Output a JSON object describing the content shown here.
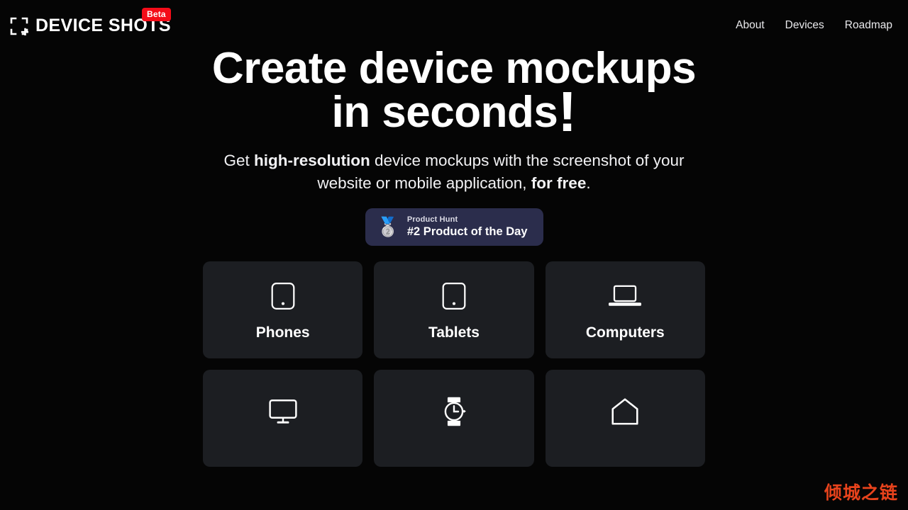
{
  "header": {
    "brand_name": "DEVICE SHOTS",
    "brand_icon": "crop-frame-plus-icon",
    "beta_label": "Beta",
    "nav": [
      {
        "label": "About"
      },
      {
        "label": "Devices"
      },
      {
        "label": "Roadmap"
      }
    ]
  },
  "hero": {
    "headline_main": "Create device mockups in seconds",
    "headline_bang": "!",
    "subhead": {
      "part1": "Get ",
      "bold1": "high-resolution",
      "part2": " device mockups with the screenshot of your website or mobile application, ",
      "bold2": "for free",
      "part3": "."
    }
  },
  "product_hunt": {
    "medal_icon": "second-place-medal-icon",
    "kicker": "Product Hunt",
    "title": "#2 Product of the Day"
  },
  "devices": [
    {
      "label": "Phones",
      "icon": "phone-icon"
    },
    {
      "label": "Tablets",
      "icon": "tablet-icon"
    },
    {
      "label": "Computers",
      "icon": "laptop-icon"
    },
    {
      "label": "",
      "icon": "monitor-icon"
    },
    {
      "label": "",
      "icon": "watch-icon"
    },
    {
      "label": "",
      "icon": "home-icon"
    }
  ],
  "watermark": {
    "text": "倾城之链"
  },
  "colors": {
    "background": "#050505",
    "card": "#1c1e22",
    "beta_red": "#f40c18",
    "product_hunt_bg": "#2b2d4c",
    "watermark": "#e8431c",
    "text": "#ffffff"
  }
}
